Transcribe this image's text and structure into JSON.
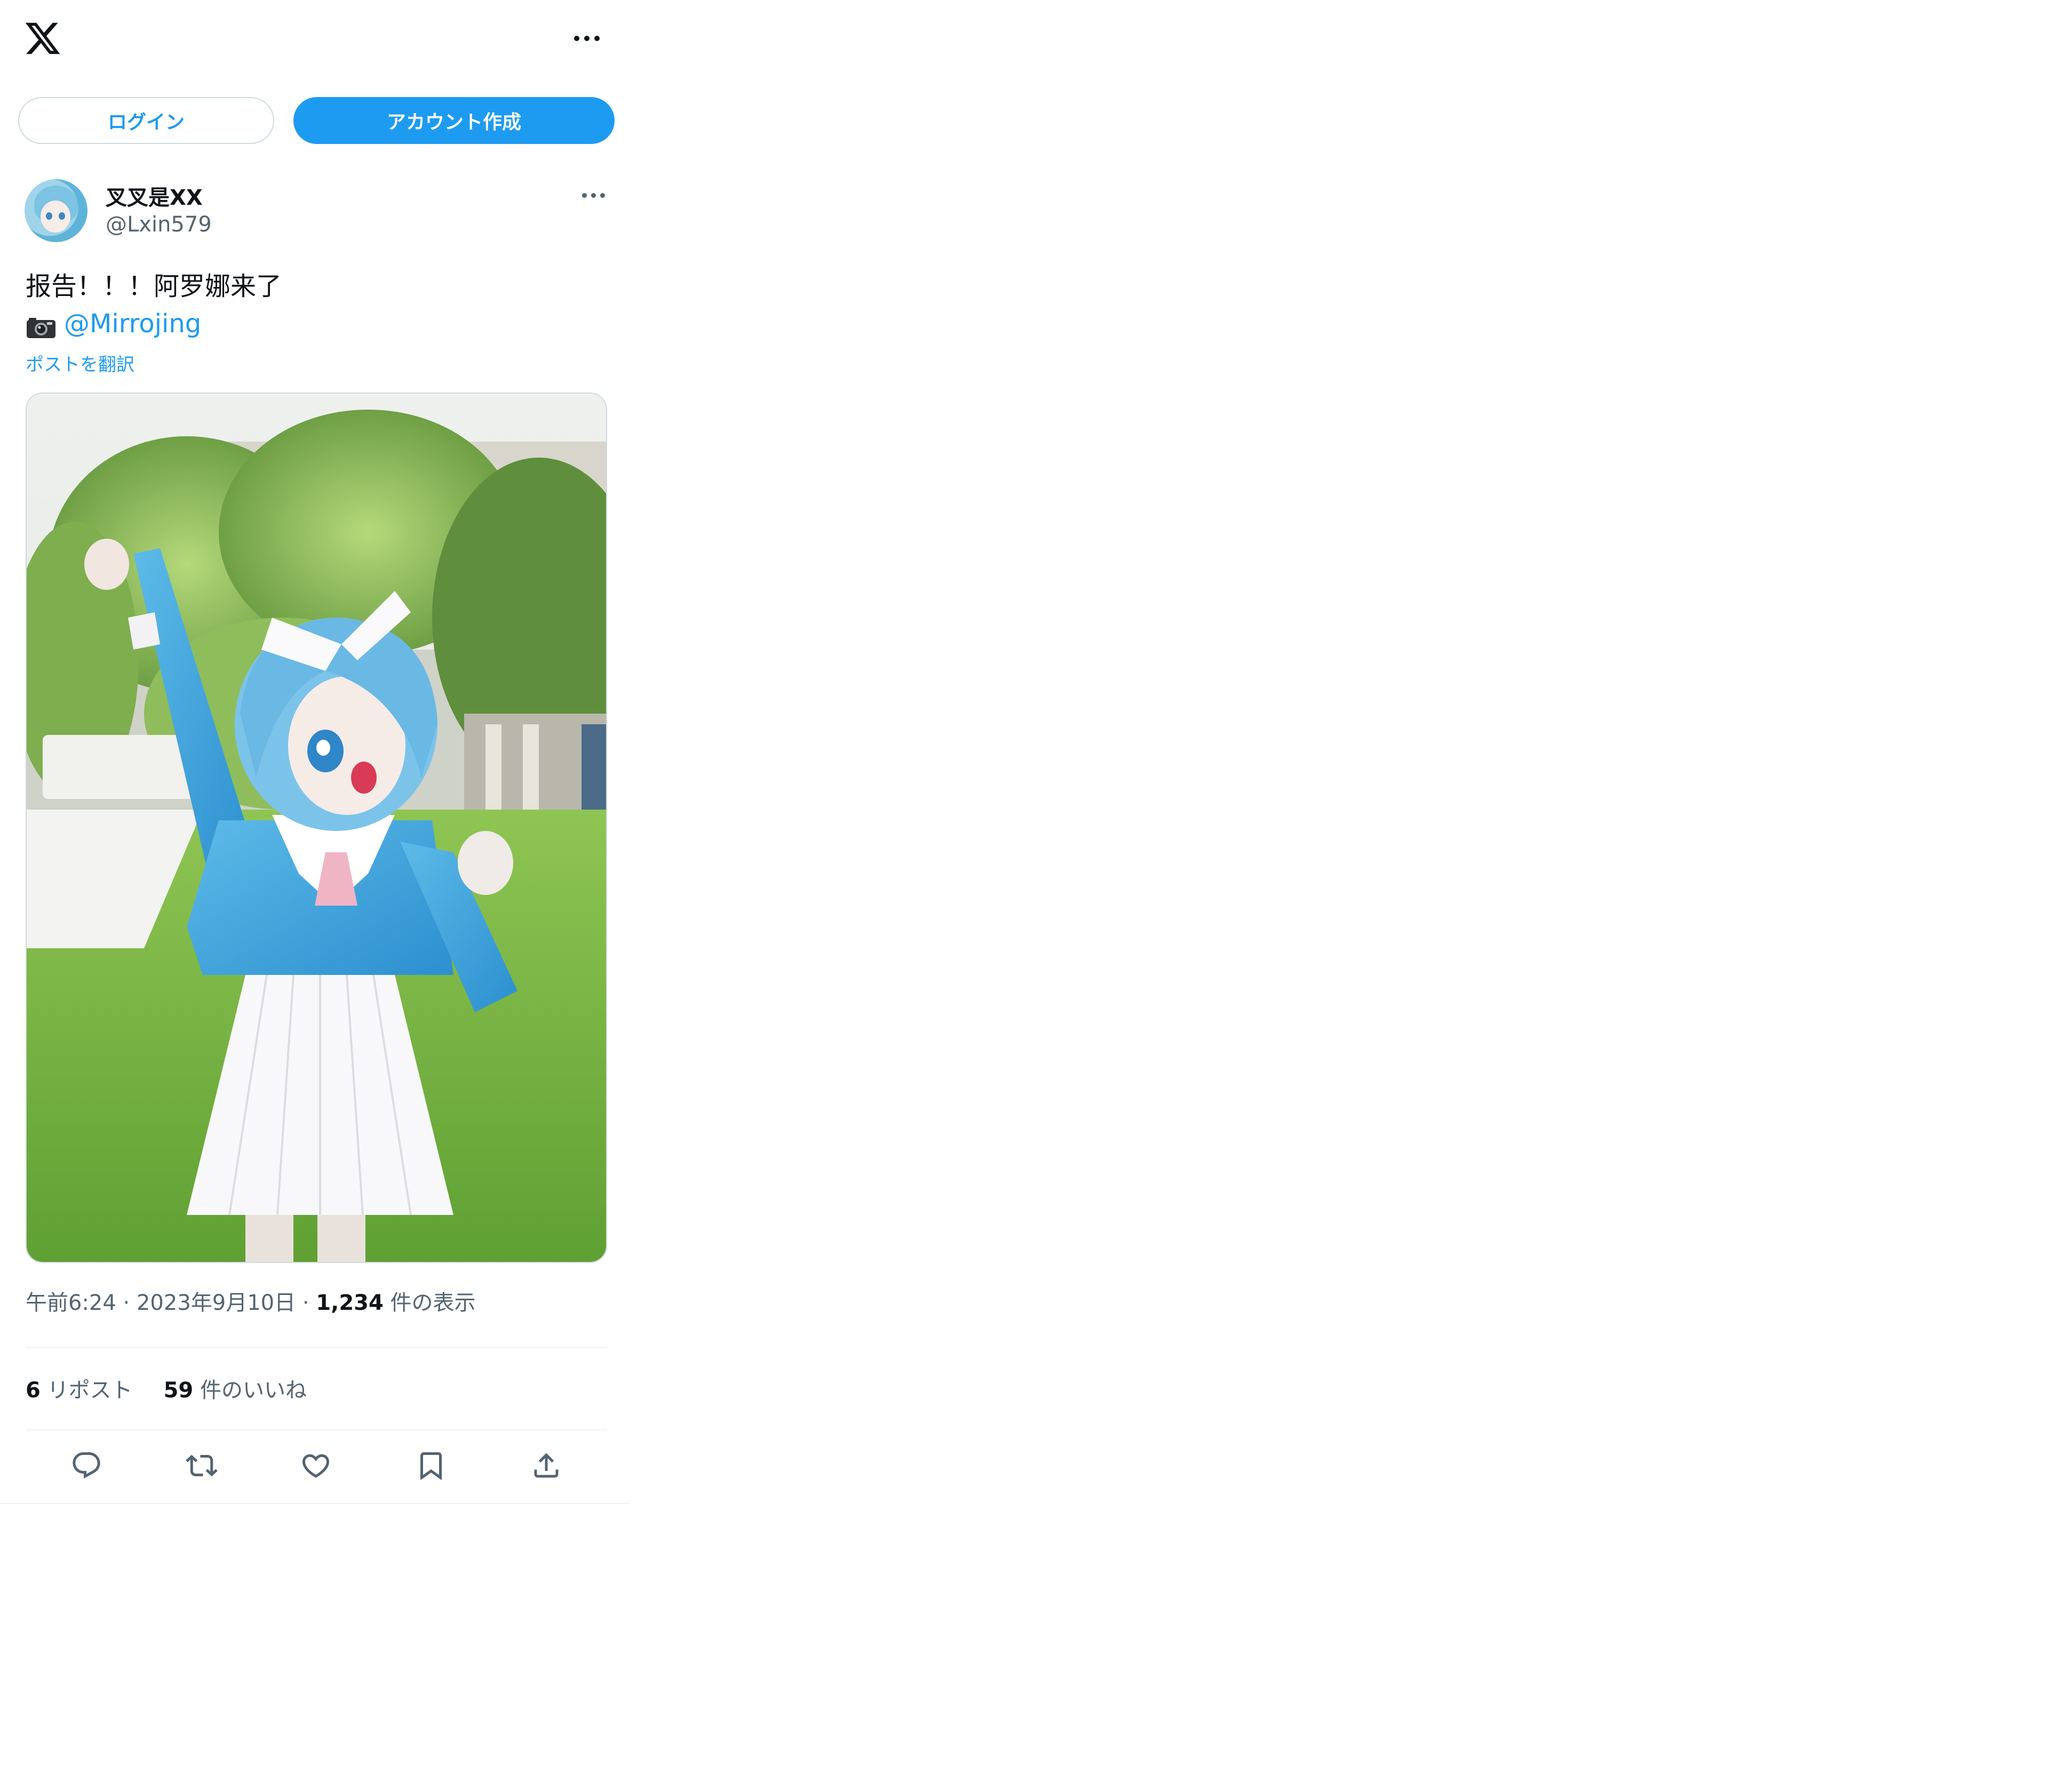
{
  "header": {
    "logo_icon": "x-logo-icon",
    "more_icon": "more-horizontal-icon"
  },
  "auth": {
    "login_label": "ログイン",
    "signup_label": "アカウント作成"
  },
  "tweet": {
    "display_name": "叉叉是XX",
    "handle": "@Lxin579",
    "text_line1": "报告！！！阿罗娜来了",
    "camera_icon": "camera-icon",
    "mention": "@Mirrojing",
    "translate_label": "ポストを翻訳",
    "time": "午前6:24",
    "separator1": " · ",
    "date": "2023年9月10日",
    "separator2": " · ",
    "views_count": "1,234",
    "views_label": "件の表示",
    "reposts_count": "6",
    "reposts_label": "リポスト",
    "likes_count": "59",
    "likes_label": "件のいいね"
  },
  "actions": [
    {
      "name": "reply-icon"
    },
    {
      "name": "repost-icon"
    },
    {
      "name": "like-icon"
    },
    {
      "name": "bookmark-icon"
    },
    {
      "name": "share-icon"
    }
  ],
  "colors": {
    "accent": "#1d9bf0",
    "text_primary": "#0f1419",
    "text_secondary": "#536471",
    "border": "#cfd9de"
  }
}
